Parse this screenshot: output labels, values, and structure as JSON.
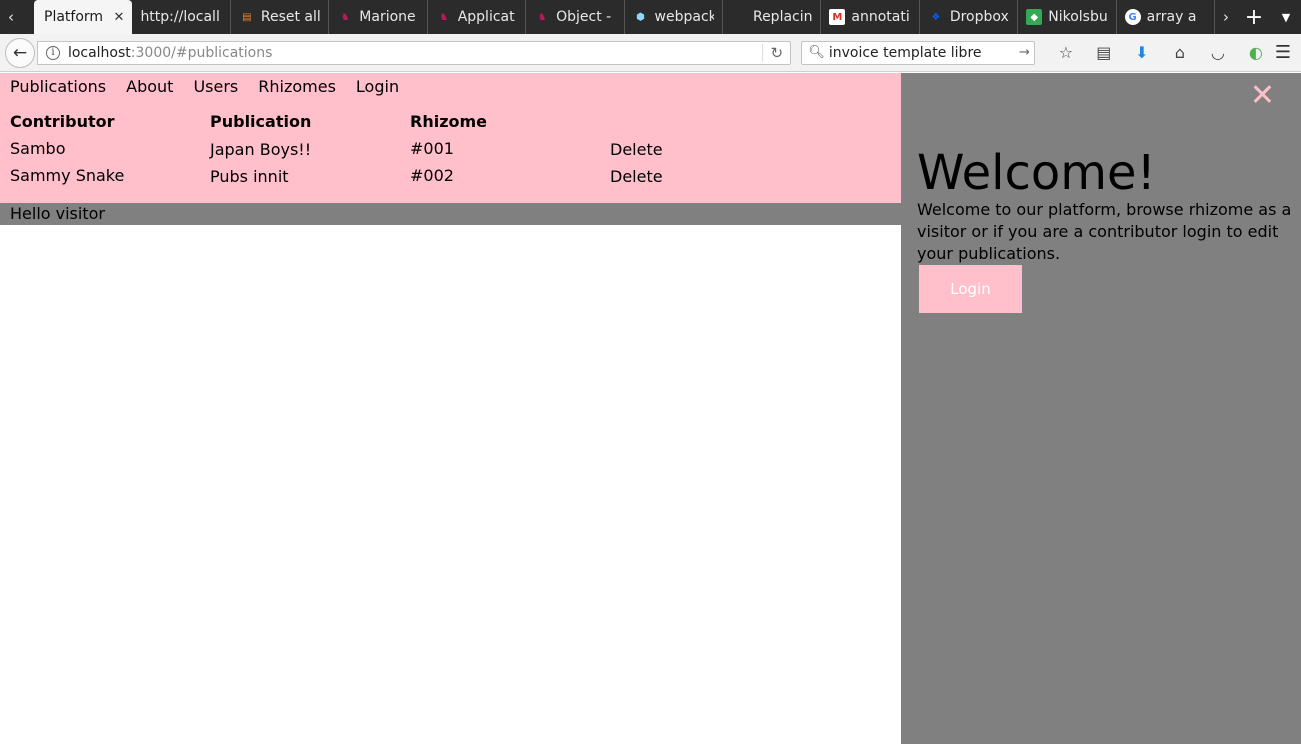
{
  "browser": {
    "tabs": [
      {
        "title": "Platform",
        "favicon": "blank-icon",
        "active": true
      },
      {
        "title": "http://locall",
        "favicon": "blank-icon"
      },
      {
        "title": "Reset all",
        "favicon": "stackoverflow-icon"
      },
      {
        "title": "Marione",
        "favicon": "marionette-icon"
      },
      {
        "title": "Applicat",
        "favicon": "marionette-icon"
      },
      {
        "title": "Object -",
        "favicon": "marionette-icon"
      },
      {
        "title": "webpack",
        "favicon": "webpack-icon"
      },
      {
        "title": "Replacin",
        "favicon": "blank-icon"
      },
      {
        "title": "annotati",
        "favicon": "gmail-icon"
      },
      {
        "title": "Dropbox",
        "favicon": "dropbox-icon"
      },
      {
        "title": "Nikolsbu",
        "favicon": "maps-icon"
      },
      {
        "title": "array a",
        "favicon": "google-icon"
      }
    ],
    "url_host": "localhost",
    "url_rest": ":3000/#publications",
    "search_value": "invoice template libre"
  },
  "nav": {
    "items": [
      "Publications",
      "About",
      "Users",
      "Rhizomes",
      "Login"
    ]
  },
  "table": {
    "headers": [
      "Contributor",
      "Publication",
      "Rhizome"
    ],
    "rows": [
      {
        "contributor": "Sambo",
        "publication": "Japan Boys!!",
        "rhizome": "#001",
        "action": "Delete"
      },
      {
        "contributor": "Sammy Snake",
        "publication": "Pubs innit",
        "rhizome": "#002",
        "action": "Delete"
      }
    ]
  },
  "status": {
    "greeting": "Hello visitor"
  },
  "side": {
    "close_glyph": "✕",
    "title": "Welcome!",
    "text": "Welcome to our platform, browse rhizome as a visitor or if you are a contributor login to edit your publications.",
    "login_label": "Login"
  },
  "colors": {
    "pink": "#ffc0cb",
    "gray": "#808080"
  }
}
